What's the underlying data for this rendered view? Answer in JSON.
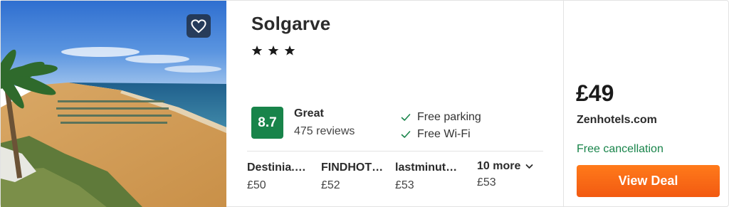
{
  "hotel": {
    "name": "Solgarve",
    "star_count": 3,
    "photo_alt": "",
    "favorite_icon": "heart-icon"
  },
  "rating": {
    "score": "8.7",
    "label": "Great",
    "reviews": "475 reviews",
    "badge_color": "#18844a"
  },
  "amenities": [
    {
      "label": "Free parking",
      "icon": "check-icon"
    },
    {
      "label": "Free Wi-Fi",
      "icon": "check-icon"
    }
  ],
  "providers": [
    {
      "name": "Destinia.…",
      "price": "£50"
    },
    {
      "name": "FINDHOT…",
      "price": "£52"
    },
    {
      "name": "lastminut…",
      "price": "£53"
    }
  ],
  "more": {
    "label": "10 more",
    "price": "£53",
    "icon": "chevron-down-icon"
  },
  "deal": {
    "price": "£49",
    "site": "Zenhotels.com",
    "cancellation": "Free cancellation",
    "button_label": "View Deal",
    "button_color": "#f25a12",
    "cancellation_color": "#18844a"
  }
}
